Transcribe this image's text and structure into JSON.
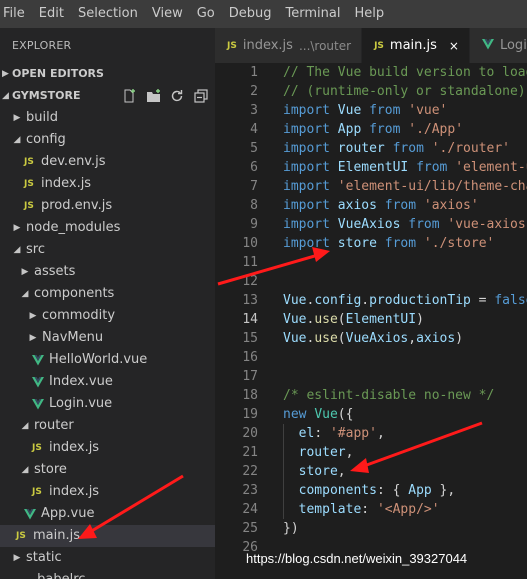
{
  "menu": [
    "File",
    "Edit",
    "Selection",
    "View",
    "Go",
    "Debug",
    "Terminal",
    "Help"
  ],
  "sidebar": {
    "title": "EXPLORER",
    "open_editors": "OPEN EDITORS",
    "project": "GYMSTORE",
    "tree": [
      {
        "label": "build",
        "kind": "folder",
        "expanded": false
      },
      {
        "label": "config",
        "kind": "folder",
        "expanded": true
      },
      {
        "label": "dev.env.js",
        "kind": "js"
      },
      {
        "label": "index.js",
        "kind": "js"
      },
      {
        "label": "prod.env.js",
        "kind": "js"
      },
      {
        "label": "node_modules",
        "kind": "folder",
        "expanded": false
      },
      {
        "label": "src",
        "kind": "folder",
        "expanded": true
      },
      {
        "label": "assets",
        "kind": "folder",
        "expanded": false
      },
      {
        "label": "components",
        "kind": "folder",
        "expanded": true
      },
      {
        "label": "commodity",
        "kind": "folder",
        "expanded": false
      },
      {
        "label": "NavMenu",
        "kind": "folder",
        "expanded": false
      },
      {
        "label": "HelloWorld.vue",
        "kind": "vue"
      },
      {
        "label": "Index.vue",
        "kind": "vue"
      },
      {
        "label": "Login.vue",
        "kind": "vue"
      },
      {
        "label": "router",
        "kind": "folder",
        "expanded": true
      },
      {
        "label": "index.js",
        "kind": "js"
      },
      {
        "label": "store",
        "kind": "folder",
        "expanded": true
      },
      {
        "label": "index.js",
        "kind": "js"
      },
      {
        "label": "App.vue",
        "kind": "vue"
      },
      {
        "label": "main.js",
        "kind": "js",
        "selected": true
      },
      {
        "label": "static",
        "kind": "folder",
        "expanded": false
      },
      {
        "label": ".babelrc",
        "kind": "file"
      }
    ]
  },
  "tabs": [
    {
      "icon": "JS",
      "label": "index.js",
      "desc": "...\\router",
      "active": false
    },
    {
      "icon": "JS",
      "label": "main.js",
      "desc": "",
      "active": true,
      "close": "×"
    },
    {
      "icon": "V",
      "label": "Logi",
      "desc": "",
      "active": false
    }
  ],
  "editor": {
    "current_line": 14,
    "lines": [
      {
        "n": "1",
        "tokens": [
          [
            "c",
            "// The Vue build version to load"
          ]
        ]
      },
      {
        "n": "2",
        "tokens": [
          [
            "c",
            "// (runtime-only or standalone)"
          ]
        ]
      },
      {
        "n": "3",
        "tokens": [
          [
            "k",
            "import"
          ],
          [
            "p",
            " "
          ],
          [
            "v",
            "Vue"
          ],
          [
            "p",
            " "
          ],
          [
            "k",
            "from"
          ],
          [
            "p",
            " "
          ],
          [
            "s",
            "'vue'"
          ]
        ]
      },
      {
        "n": "4",
        "tokens": [
          [
            "k",
            "import"
          ],
          [
            "p",
            " "
          ],
          [
            "v",
            "App"
          ],
          [
            "p",
            " "
          ],
          [
            "k",
            "from"
          ],
          [
            "p",
            " "
          ],
          [
            "s",
            "'./App'"
          ]
        ]
      },
      {
        "n": "5",
        "tokens": [
          [
            "k",
            "import"
          ],
          [
            "p",
            " "
          ],
          [
            "v",
            "router"
          ],
          [
            "p",
            " "
          ],
          [
            "k",
            "from"
          ],
          [
            "p",
            " "
          ],
          [
            "s",
            "'./router'"
          ]
        ]
      },
      {
        "n": "6",
        "tokens": [
          [
            "k",
            "import"
          ],
          [
            "p",
            " "
          ],
          [
            "v",
            "ElementUI"
          ],
          [
            "p",
            " "
          ],
          [
            "k",
            "from"
          ],
          [
            "p",
            " "
          ],
          [
            "s",
            "'element-ui'"
          ]
        ]
      },
      {
        "n": "7",
        "tokens": [
          [
            "k",
            "import"
          ],
          [
            "p",
            " "
          ],
          [
            "s",
            "'element-ui/lib/theme-chalk/index.css'"
          ]
        ]
      },
      {
        "n": "8",
        "tokens": [
          [
            "k",
            "import"
          ],
          [
            "p",
            " "
          ],
          [
            "v",
            "axios"
          ],
          [
            "p",
            " "
          ],
          [
            "k",
            "from"
          ],
          [
            "p",
            " "
          ],
          [
            "s",
            "'axios'"
          ]
        ]
      },
      {
        "n": "9",
        "tokens": [
          [
            "k",
            "import"
          ],
          [
            "p",
            " "
          ],
          [
            "v",
            "VueAxios"
          ],
          [
            "p",
            " "
          ],
          [
            "k",
            "from"
          ],
          [
            "p",
            " "
          ],
          [
            "s",
            "'vue-axios'"
          ]
        ]
      },
      {
        "n": "10",
        "tokens": [
          [
            "k",
            "import"
          ],
          [
            "p",
            " "
          ],
          [
            "v",
            "store"
          ],
          [
            "p",
            " "
          ],
          [
            "k",
            "from"
          ],
          [
            "p",
            " "
          ],
          [
            "s",
            "'./store'"
          ]
        ]
      },
      {
        "n": "11",
        "tokens": []
      },
      {
        "n": "12",
        "tokens": []
      },
      {
        "n": "13",
        "tokens": [
          [
            "v",
            "Vue"
          ],
          [
            "p",
            "."
          ],
          [
            "v",
            "config"
          ],
          [
            "p",
            "."
          ],
          [
            "v",
            "productionTip"
          ],
          [
            "p",
            " = "
          ],
          [
            "k",
            "false"
          ]
        ]
      },
      {
        "n": "14",
        "tokens": [
          [
            "v",
            "Vue"
          ],
          [
            "p",
            "."
          ],
          [
            "f",
            "use"
          ],
          [
            "p",
            "("
          ],
          [
            "v",
            "ElementUI"
          ],
          [
            "p",
            ")"
          ]
        ]
      },
      {
        "n": "15",
        "tokens": [
          [
            "v",
            "Vue"
          ],
          [
            "p",
            "."
          ],
          [
            "f",
            "use"
          ],
          [
            "p",
            "("
          ],
          [
            "v",
            "VueAxios"
          ],
          [
            "p",
            ","
          ],
          [
            "v",
            "axios"
          ],
          [
            "p",
            ")"
          ]
        ]
      },
      {
        "n": "16",
        "tokens": []
      },
      {
        "n": "17",
        "tokens": []
      },
      {
        "n": "18",
        "tokens": [
          [
            "c",
            "/* eslint-disable no-new */"
          ]
        ]
      },
      {
        "n": "19",
        "tokens": [
          [
            "k",
            "new"
          ],
          [
            "p",
            " "
          ],
          [
            "t",
            "Vue"
          ],
          [
            "p",
            "({"
          ]
        ]
      },
      {
        "n": "20",
        "tokens": [
          [
            "p",
            "  "
          ],
          [
            "v",
            "el"
          ],
          [
            "p",
            ": "
          ],
          [
            "s",
            "'#app'"
          ],
          [
            "p",
            ","
          ]
        ]
      },
      {
        "n": "21",
        "tokens": [
          [
            "p",
            "  "
          ],
          [
            "v",
            "router"
          ],
          [
            "p",
            ","
          ]
        ]
      },
      {
        "n": "22",
        "tokens": [
          [
            "p",
            "  "
          ],
          [
            "v",
            "store"
          ],
          [
            "p",
            ","
          ]
        ]
      },
      {
        "n": "23",
        "tokens": [
          [
            "p",
            "  "
          ],
          [
            "v",
            "components"
          ],
          [
            "p",
            ": { "
          ],
          [
            "v",
            "App"
          ],
          [
            "p",
            " },"
          ]
        ]
      },
      {
        "n": "24",
        "tokens": [
          [
            "p",
            "  "
          ],
          [
            "v",
            "template"
          ],
          [
            "p",
            ": "
          ],
          [
            "s",
            "'<App/>'"
          ]
        ]
      },
      {
        "n": "25",
        "tokens": [
          [
            "p",
            "})"
          ]
        ]
      },
      {
        "n": "26",
        "tokens": []
      }
    ]
  },
  "watermark": "https://blog.csdn.net/weixin_39327044",
  "colors": {
    "annotation_arrow": "#ff1a1a",
    "editor_bg": "#1e1e1e",
    "sidebar_bg": "#252526"
  }
}
